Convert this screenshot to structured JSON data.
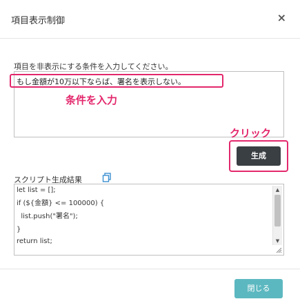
{
  "dialog": {
    "title": "項目表示制御",
    "close_glyph": "×"
  },
  "condition": {
    "label": "項目を非表示にする条件を入力してください。",
    "value": "もし金額が10万以下ならば、署名を表示しない。"
  },
  "annotations": {
    "input": "条件を入力",
    "click": "クリック"
  },
  "generate_button": {
    "label": "生成"
  },
  "result": {
    "label": "スクリプト生成結果",
    "lines": [
      "let list = [];",
      "if (${金額} <= 100000) {",
      "  list.push(\"署名\");",
      "}",
      "return list;"
    ]
  },
  "scrollbar": {
    "up_glyph": "▲",
    "down_glyph": "▼"
  },
  "footer": {
    "close_label": "閉じる"
  },
  "colors": {
    "highlight": "#e3276c",
    "generate_button": "#3a3f44",
    "close_button": "#5cb8c0",
    "copy_icon": "#3a8fd0"
  },
  "icons": {
    "copy": "copy-icon",
    "close": "close-icon",
    "resize": "resize-grip-icon"
  }
}
